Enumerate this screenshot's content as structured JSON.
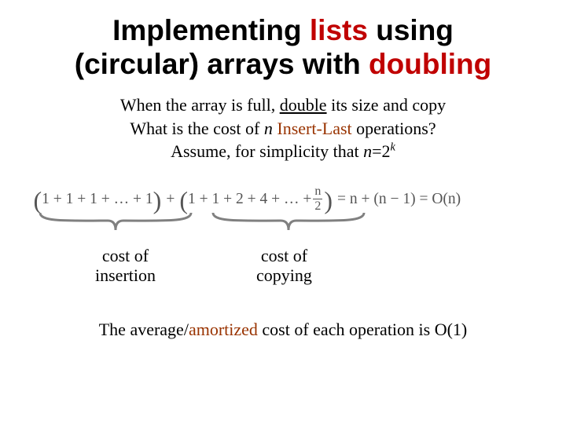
{
  "title": {
    "t1": "Implementing ",
    "t2_lists": "lists",
    "t3": " using",
    "t4": "(circular) arrays with ",
    "t5_doubling": "doubling"
  },
  "lead": {
    "l1a": "When the array is full, ",
    "l1b_double": "double",
    "l1c": " its size and copy",
    "l2a": "What is the cost of ",
    "l2b_n": "n",
    "l2c": " ",
    "l2d_op": "Insert-Last",
    "l2e": " operations?",
    "l3a": "Assume, for simplicity that ",
    "l3b_n": "n",
    "l3c": "=2",
    "l3d_k": "k"
  },
  "eq": {
    "g1_open": "(",
    "g1_body": "1 + 1 + 1 + … + 1",
    "g1_close": ")",
    "plus1": " + ",
    "g2_open": "(",
    "g2_body_a": "1 + 1 + 2 + 4 + … + ",
    "frac_num": "n",
    "frac_den": "2",
    "g2_close": ")",
    "rhs": " =  n + (n − 1)  =  O(n)"
  },
  "labels": {
    "left_l1": "cost of",
    "left_l2": "insertion",
    "right_l1": "cost of",
    "right_l2": "copying"
  },
  "closing": {
    "a": "The average/",
    "b_amortized": "amortized",
    "c": " cost of each operation is O(1)"
  }
}
